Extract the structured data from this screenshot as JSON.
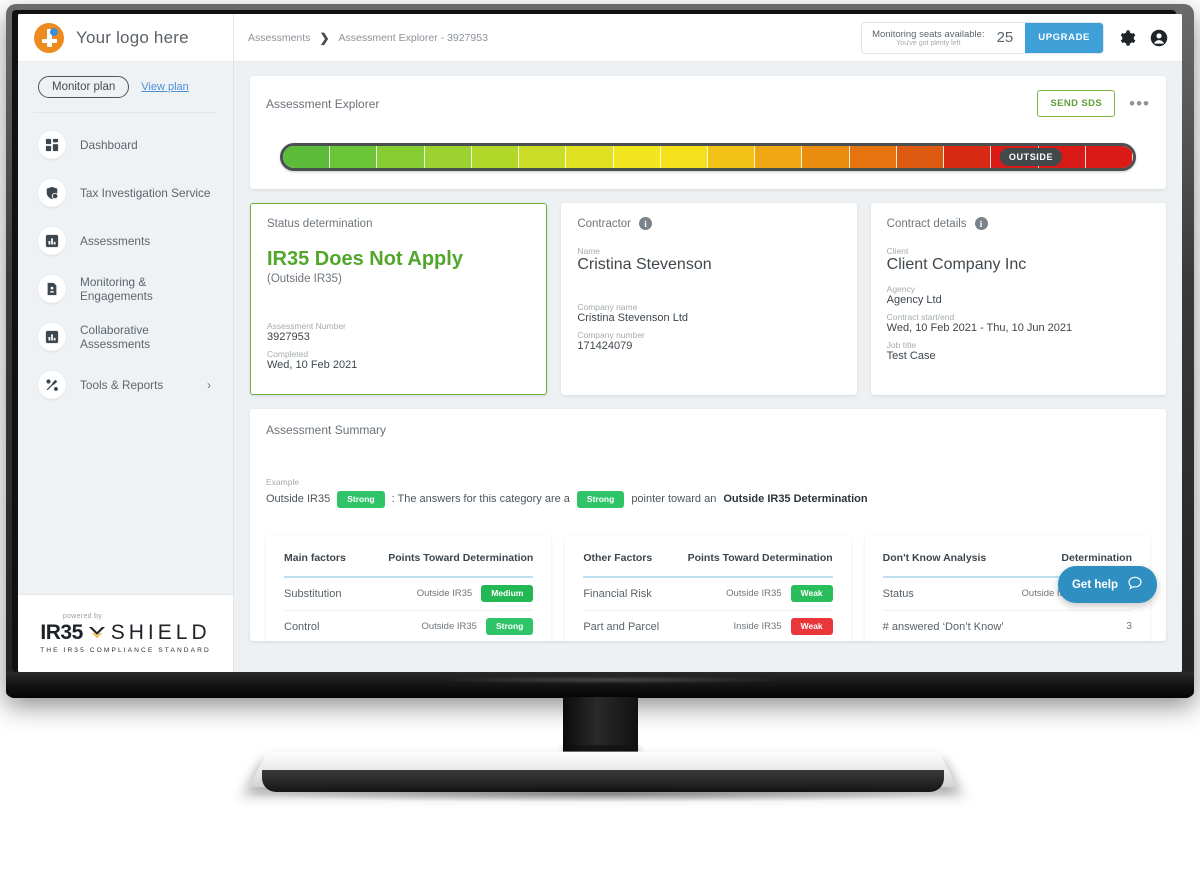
{
  "brand": {
    "logo_text": "Your logo here",
    "logo_icon": "orange-circle-person-icon"
  },
  "sidebar": {
    "plan_pill": "Monitor plan",
    "plan_link": "View plan",
    "items": [
      {
        "label": "Dashboard",
        "icon": "grid-icon"
      },
      {
        "label": "Tax Investigation Service",
        "icon": "shield-pound-icon"
      },
      {
        "label": "Assessments",
        "icon": "bar-chart-icon"
      },
      {
        "label": "Monitoring & Engagements",
        "icon": "document-icon"
      },
      {
        "label": "Collaborative Assessments",
        "icon": "bar-chart-icon"
      },
      {
        "label": "Tools & Reports",
        "icon": "tools-icon",
        "chevron": "›"
      }
    ],
    "footer": {
      "powered_by": "powered by",
      "logo_primary": "IR35",
      "logo_secondary": "SHIELD",
      "tagline": "THE IR35 COMPLIANCE STANDARD"
    }
  },
  "topbar": {
    "breadcrumb": [
      "Assessments",
      "Assessment Explorer - 3927953"
    ],
    "breadcrumb_separator": "❯",
    "seats_title": "Monitoring seats available:",
    "seats_sub": "You've got plenty left",
    "seats_count": "25",
    "upgrade_label": "UPGRADE",
    "settings_icon": "gear-icon",
    "account_icon": "user-avatar-icon"
  },
  "explorer": {
    "title": "Assessment Explorer",
    "send_sds_label": "SEND SDS",
    "kebab_label": "•••",
    "gauge": {
      "marker_label": "OUTSIDE",
      "marker_position_percent": 88,
      "segment_count": 18,
      "colors": [
        "#d91a16",
        "#d91a16",
        "#d81b16",
        "#d62b12",
        "#df5a11",
        "#e5740f",
        "#e98c10",
        "#efa713",
        "#f2c218",
        "#f6e01c",
        "#f2e61e",
        "#dfe122",
        "#c9dc26",
        "#b2d72b",
        "#9bd22f",
        "#86cd33",
        "#6cc437",
        "#5dbb3a"
      ]
    }
  },
  "status_card": {
    "title": "Status determination",
    "headline": "IR35 Does Not Apply",
    "subhead": "(Outside IR35)",
    "fields": [
      {
        "label": "Assessment Number",
        "value": "3927953"
      },
      {
        "label": "Completed",
        "value": "Wed, 10 Feb 2021"
      }
    ],
    "accent_color": "#6db23f"
  },
  "contractor_card": {
    "title": "Contractor",
    "info_icon": "info-icon",
    "name_label": "Name",
    "name_value": "Cristina Stevenson",
    "fields": [
      {
        "label": "Company name",
        "value": "Cristina Stevenson Ltd"
      },
      {
        "label": "Company number",
        "value": "171424079"
      }
    ]
  },
  "contract_card": {
    "title": "Contract details",
    "info_icon": "info-icon",
    "client_label": "Client",
    "client_value": "Client Company Inc",
    "fields": [
      {
        "label": "Agency",
        "value": "Agency Ltd"
      },
      {
        "label": "Contract start/end",
        "value": "Wed, 10 Feb 2021 - Thu, 10 Jun 2021"
      },
      {
        "label": "Job title",
        "value": "Test Case"
      }
    ]
  },
  "summary": {
    "title": "Assessment Summary",
    "example_label": "Example",
    "example_prefix": "Outside IR35",
    "example_pill_1": "Strong",
    "example_mid": ": The answers for this category are a",
    "example_pill_2": "Strong",
    "example_suffix": "pointer toward an",
    "example_bold": "Outside IR35 Determination",
    "tables": [
      {
        "col1": "Main factors",
        "col2": "Points Toward Determination",
        "rows": [
          {
            "label": "Substitution",
            "determination": "Outside IR35",
            "pill": "Medium",
            "pill_type": "medium"
          },
          {
            "label": "Control",
            "determination": "Outside IR35",
            "pill": "Strong",
            "pill_type": "strong"
          }
        ]
      },
      {
        "col1": "Other Factors",
        "col2": "Points Toward Determination",
        "rows": [
          {
            "label": "Financial Risk",
            "determination": "Outside IR35",
            "pill": "Weak",
            "pill_type": "weak-green"
          },
          {
            "label": "Part and Parcel",
            "determination": "Inside IR35",
            "pill": "Weak",
            "pill_type": "weak-red"
          }
        ]
      },
      {
        "col1": "Don't Know Analysis",
        "col2": "Determination",
        "rows": [
          {
            "label": "Status",
            "determination": "Outside IR35",
            "pill": "",
            "pill_type": "blank"
          },
          {
            "label": "# answered ‘Don’t Know’",
            "determination": "",
            "pill": "",
            "pill_type": "none",
            "number": "3"
          }
        ]
      }
    ]
  },
  "get_help": {
    "label": "Get help",
    "icon": "chat-bubble-icon"
  }
}
